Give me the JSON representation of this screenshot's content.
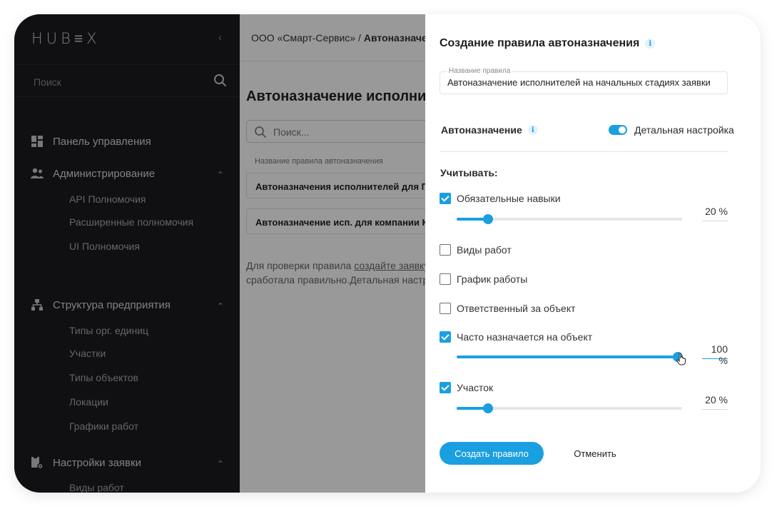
{
  "sidebar": {
    "logo": "HUB≡X",
    "collapse_icon": "chevron-left-icon",
    "search_placeholder": "Поиск",
    "sections": [
      {
        "label": "Панель управления",
        "icon": "dashboard-icon",
        "items": []
      },
      {
        "label": "Администрирование",
        "icon": "users-icon",
        "items": [
          "API Полномочия",
          "Расширенные полномочия",
          "UI Полномочия"
        ]
      },
      {
        "label": "Структура предприятия",
        "icon": "hierarchy-icon",
        "items": [
          "Типы орг. единиц",
          "Участки",
          "Типы объектов",
          "Локации",
          "Графики работ"
        ]
      },
      {
        "label": "Настройки заявки",
        "icon": "request-settings-icon",
        "items": [
          "Виды работ"
        ]
      }
    ]
  },
  "main": {
    "breadcrumb_org": "ООО «Смарт-Сервис» /",
    "breadcrumb_page": "Автоназначе",
    "title": "Автоназначение исполни",
    "search_placeholder": "Поиск...",
    "column_header": "Название правила автоназначения",
    "rules": [
      "Автоназначения исполнителей для Газп",
      "Автоназначение исп. для компании Кли"
    ],
    "hint_prefix": "Для проверки правила",
    "hint_link": "создайте заявку",
    "hint_line2": "сработала правильно.Детальная настр"
  },
  "drawer": {
    "title": "Создание правила автоназначения",
    "info_glyph": "i",
    "name_label": "Название правила",
    "name_value": "Автоназначение исполнителей на начальных стадиях заявки",
    "auto_label": "Автоназначение",
    "toggle_label": "Детальная настройка",
    "toggle_on": true,
    "consider_label": "Учитывать:",
    "criteria": [
      {
        "label": "Обязательные навыки",
        "checked": true,
        "value": 20,
        "percent_text": "20 %"
      },
      {
        "label": "Виды работ",
        "checked": false
      },
      {
        "label": "График работы",
        "checked": false
      },
      {
        "label": "Ответственный за объект",
        "checked": false
      },
      {
        "label": "Часто назначается на объект",
        "checked": true,
        "value": 100,
        "percent_text": "100 %"
      },
      {
        "label": "Участок",
        "checked": true,
        "value": 20,
        "percent_text": "20 %"
      }
    ],
    "create_button": "Создать правило",
    "cancel_button": "Отменить"
  },
  "colors": {
    "accent": "#1a9fe0",
    "sidebar_bg": "#1c1c1e",
    "overlay": "rgba(0,0,0,0.40)"
  }
}
